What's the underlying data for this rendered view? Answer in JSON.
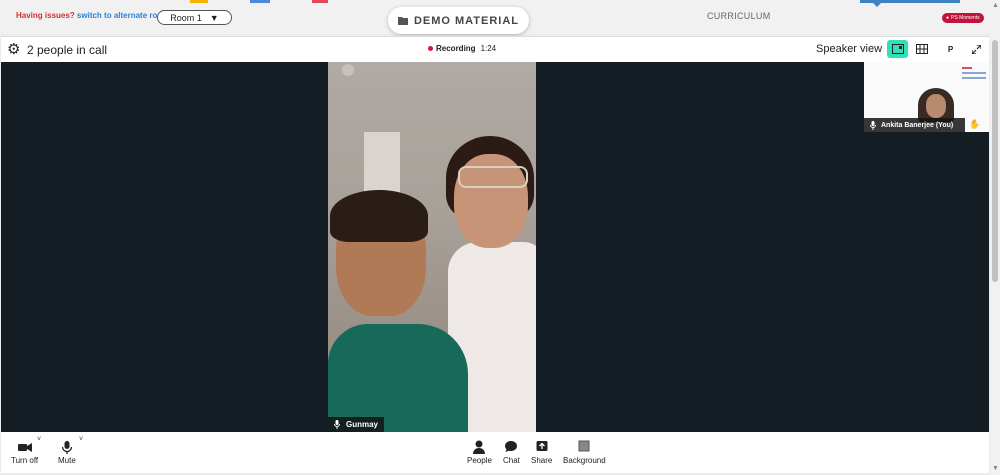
{
  "topbar": {
    "issue_text": "Having issues?",
    "switch_link": "switch to alternate room",
    "room_select": "Room 1",
    "demo_material_label": "DEMO MATERIAL",
    "curriculum_label": "CURRICULUM",
    "moments_label": "PS Moments"
  },
  "call_header": {
    "people_count": "2 people in call",
    "recording_label": "Recording",
    "recording_time": "1:24",
    "view_label": "Speaker view",
    "presenter_button": "P"
  },
  "participants": {
    "main_name": "Gunmay",
    "self_name": "Ankita Banerjee (You)"
  },
  "controls": {
    "camera_label": "Turn off",
    "mic_label": "Mute",
    "people_label": "People",
    "chat_label": "Chat",
    "share_label": "Share",
    "background_label": "Background"
  },
  "colors": {
    "accent_view": "#2fe0b8",
    "recording_dot": "#d0143c",
    "issue_red": "#d0312d",
    "link_blue": "#2f7fd1",
    "stage_bg": "#141c24"
  },
  "icons": {
    "settings": "gear-icon",
    "folder": "folder-icon",
    "camera": "video-camera-icon",
    "mic": "microphone-icon",
    "people": "person-icon",
    "chat": "chat-bubble-icon",
    "share": "share-screen-icon",
    "background": "background-icon",
    "fullscreen": "expand-icon",
    "grid": "grid-view-icon",
    "speaker_view": "speaker-view-icon",
    "raise_hand": "hand-icon"
  }
}
